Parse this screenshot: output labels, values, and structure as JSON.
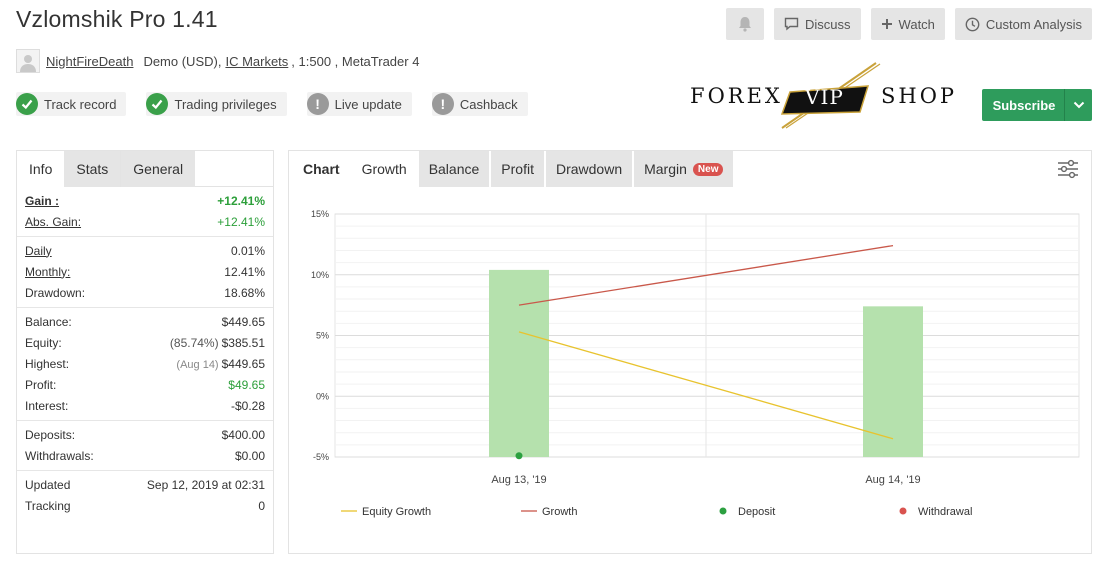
{
  "header": {
    "title": "Vzlomshik Pro 1.41",
    "actions": {
      "discuss": "Discuss",
      "watch": "Watch",
      "custom_analysis": "Custom Analysis"
    }
  },
  "account": {
    "user": "NightFireDeath",
    "type": "Demo (USD),",
    "broker": "IC Markets",
    "details": ", 1:500 , MetaTrader 4"
  },
  "badges": [
    {
      "label": "Track record",
      "status": "ok"
    },
    {
      "label": "Trading privileges",
      "status": "ok"
    },
    {
      "label": "Live update",
      "status": "warn"
    },
    {
      "label": "Cashback",
      "status": "warn"
    }
  ],
  "logo": {
    "left": "FOREX",
    "mid": "VIP",
    "right": "SHOP"
  },
  "subscribe": {
    "label": "Subscribe"
  },
  "left_tabs": {
    "info": "Info",
    "stats": "Stats",
    "general": "General"
  },
  "stats": {
    "gain": {
      "label": "Gain :",
      "value": "+12.41%"
    },
    "abs_gain": {
      "label": "Abs. Gain:",
      "value": "+12.41%"
    },
    "daily": {
      "label": "Daily",
      "value": "0.01%"
    },
    "monthly": {
      "label": "Monthly:",
      "value": "12.41%"
    },
    "drawdown": {
      "label": "Drawdown:",
      "value": "18.68%"
    },
    "balance": {
      "label": "Balance:",
      "value": "$449.65"
    },
    "equity": {
      "label": "Equity:",
      "note": "(85.74%)",
      "value": "$385.51"
    },
    "highest": {
      "label": "Highest:",
      "note": "(Aug 14)",
      "value": "$449.65"
    },
    "profit": {
      "label": "Profit:",
      "value": "$49.65"
    },
    "interest": {
      "label": "Interest:",
      "value": "-$0.28"
    },
    "deposits": {
      "label": "Deposits:",
      "value": "$400.00"
    },
    "withdrawals": {
      "label": "Withdrawals:",
      "value": "$0.00"
    },
    "updated": {
      "label": "Updated",
      "value": "Sep 12, 2019 at 02:31"
    },
    "tracking": {
      "label": "Tracking",
      "value": "0"
    }
  },
  "chart_tabs": {
    "chart": "Chart",
    "growth": "Growth",
    "balance": "Balance",
    "profit": "Profit",
    "drawdown": "Drawdown",
    "margin": "Margin",
    "new_tag": "New"
  },
  "chart_data": {
    "type": "bar",
    "categories": [
      "Aug 13, '19",
      "Aug 14, '19"
    ],
    "ylim": [
      -5,
      15
    ],
    "yticks": [
      "15%",
      "10%",
      "5%",
      "0%",
      "-5%"
    ],
    "ytick_values": [
      15,
      10,
      5,
      0,
      -5
    ],
    "bars": {
      "values": [
        10.4,
        7.4
      ],
      "color": "#b5e1ad"
    },
    "series": [
      {
        "name": "Equity Growth",
        "type": "line",
        "values": [
          5.3,
          -3.5
        ],
        "color": "#e8c32e"
      },
      {
        "name": "Growth",
        "type": "line",
        "values": [
          7.5,
          12.4
        ],
        "color": "#c9584a"
      },
      {
        "name": "Deposit",
        "type": "marker",
        "values": [
          -4.9,
          null
        ],
        "color": "#2ca040"
      },
      {
        "name": "Withdrawal",
        "type": "marker",
        "values": [
          null,
          null
        ],
        "color": "#d9534f"
      }
    ],
    "grid": true,
    "legend": "bottom"
  }
}
